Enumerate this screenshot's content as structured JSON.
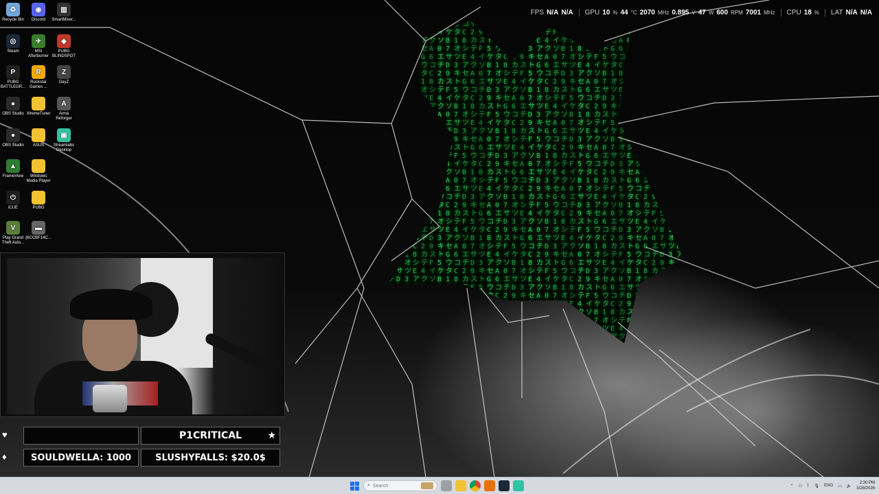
{
  "overlay": {
    "fps_label": "FPS",
    "fps_value1": "N/A",
    "fps_value2": "N/A",
    "gpu_label": "GPU",
    "gpu_usage": "10",
    "gpu_usage_unit": "%",
    "gpu_temp": "44",
    "gpu_temp_unit": "°C",
    "gpu_clock": "2070",
    "gpu_clock_unit": "MHz",
    "gpu_voltage": "0.895",
    "gpu_voltage_unit": "V",
    "gpu_power": "47",
    "gpu_power_unit": "W",
    "gpu_fan": "600",
    "gpu_fan_unit": "RPM",
    "gpu_mem_clock": "7001",
    "gpu_mem_clock_unit": "MHz",
    "cpu_label": "CPU",
    "cpu_usage": "18",
    "cpu_usage_unit": "%",
    "lat_label": "LAT",
    "lat_value1": "N/A",
    "lat_value2": "N/A"
  },
  "desktop_icons": [
    {
      "label": "Recycle Bin",
      "icon": "recycle-bin-icon",
      "color": "#6fa8dc",
      "glyph": "♻"
    },
    {
      "label": "Discord",
      "icon": "discord-icon",
      "color": "#5865f2",
      "glyph": "◉"
    },
    {
      "label": "SmartMixer...",
      "icon": "smartmixer-icon",
      "color": "#333333",
      "glyph": "▥"
    },
    {
      "label": "Steam",
      "icon": "steam-icon",
      "color": "#1b2838",
      "glyph": "◎"
    },
    {
      "label": "MSI Afterburner",
      "icon": "afterburner-icon",
      "color": "#3a7d2c",
      "glyph": "✈"
    },
    {
      "label": "PUBG BLINDSPOT",
      "icon": "pubg-blindspot-icon",
      "color": "#c0392b",
      "glyph": "◆"
    },
    {
      "label": "PUBG BATTLEGR...",
      "icon": "pubg-icon",
      "color": "#222222",
      "glyph": "P"
    },
    {
      "label": "Rockstar Games ...",
      "icon": "rockstar-icon",
      "color": "#f2a900",
      "glyph": "R"
    },
    {
      "label": "DayZ",
      "icon": "dayz-icon",
      "color": "#444444",
      "glyph": "Z"
    },
    {
      "label": "OBS Studio",
      "icon": "obs-icon",
      "color": "#2b2b2b",
      "glyph": "●"
    },
    {
      "label": "XtremeTuner",
      "icon": "folder-icon",
      "color": "#f1c232",
      "glyph": ""
    },
    {
      "label": "Arma Reforger",
      "icon": "arma-icon",
      "color": "#555555",
      "glyph": "A"
    },
    {
      "label": "OBS Studio",
      "icon": "obs-icon",
      "color": "#2b2b2b",
      "glyph": "●"
    },
    {
      "label": "ASUS",
      "icon": "folder-icon",
      "color": "#f1c232",
      "glyph": ""
    },
    {
      "label": "Streamlabs Desktop",
      "icon": "streamlabs-icon",
      "color": "#31c3a2",
      "glyph": "▣"
    },
    {
      "label": "FrameView",
      "icon": "frameview-icon",
      "color": "#2e7d32",
      "glyph": "▲"
    },
    {
      "label": "Windows Media Player",
      "icon": "folder-icon",
      "color": "#f1c232",
      "glyph": ""
    },
    {
      "label": "iCUE",
      "icon": "icue-icon",
      "color": "#1e1e1e",
      "glyph": "⏻"
    },
    {
      "label": "PUBG",
      "icon": "folder-icon",
      "color": "#f1c232",
      "glyph": ""
    },
    {
      "label": "Play Grand Theft Auto...",
      "icon": "gta-icon",
      "color": "#5a7d3a",
      "glyph": "V"
    },
    {
      "label": "{6CCBF14C...",
      "icon": "file-icon",
      "color": "#666666",
      "glyph": "▬"
    }
  ],
  "bottom_bar": {
    "heart_symbol": "♥",
    "drop_symbol": "♦",
    "star_symbol": "★",
    "latest_follower": "P1CRITICAL",
    "top_bits": "SOULDWELLA: 1000",
    "top_donation": "SLUSHYFALLS: $20.0$"
  },
  "taskbar": {
    "search_placeholder": "Search",
    "language": "ENG",
    "time": "2:30 PM",
    "date": "3/28/2026"
  }
}
